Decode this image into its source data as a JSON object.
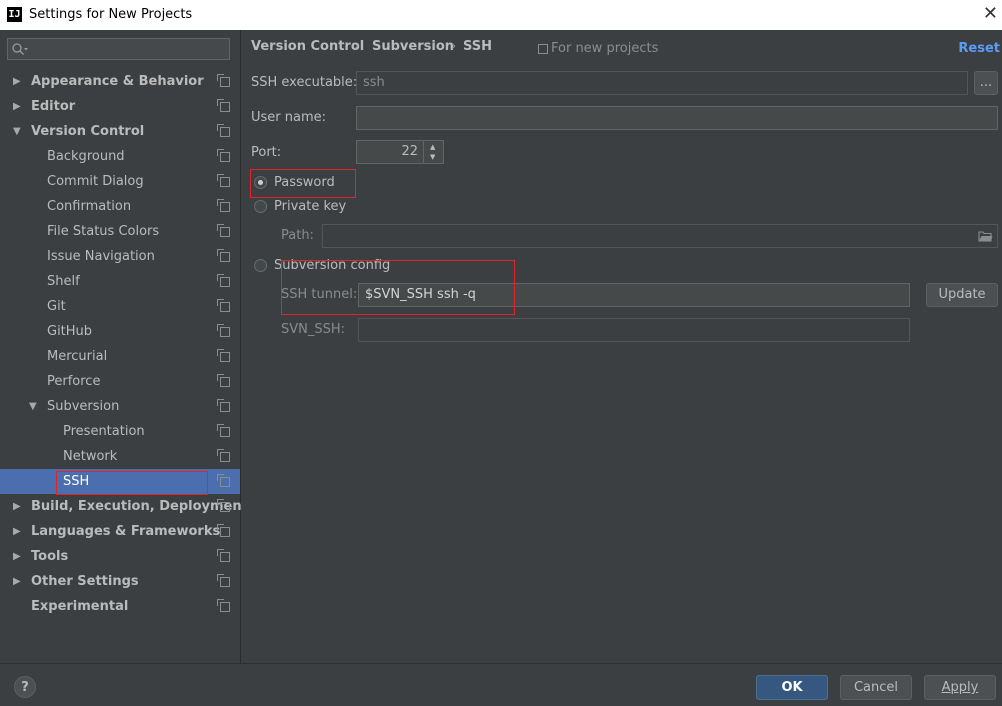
{
  "window": {
    "app_icon": "IJ",
    "title": "Settings for New Projects",
    "close": "✕"
  },
  "search": {
    "placeholder": "",
    "icon": "search-icon"
  },
  "tree": [
    {
      "label": "Appearance & Behavior",
      "bold": true,
      "arrow": "▶",
      "level": 0
    },
    {
      "label": "Editor",
      "bold": true,
      "arrow": "▶",
      "level": 0
    },
    {
      "label": "Version Control",
      "bold": true,
      "arrow": "▼",
      "level": 0
    },
    {
      "label": "Background",
      "bold": false,
      "arrow": "",
      "level": 1
    },
    {
      "label": "Commit Dialog",
      "bold": false,
      "arrow": "",
      "level": 1
    },
    {
      "label": "Confirmation",
      "bold": false,
      "arrow": "",
      "level": 1
    },
    {
      "label": "File Status Colors",
      "bold": false,
      "arrow": "",
      "level": 1
    },
    {
      "label": "Issue Navigation",
      "bold": false,
      "arrow": "",
      "level": 1
    },
    {
      "label": "Shelf",
      "bold": false,
      "arrow": "",
      "level": 1
    },
    {
      "label": "Git",
      "bold": false,
      "arrow": "",
      "level": 1
    },
    {
      "label": "GitHub",
      "bold": false,
      "arrow": "",
      "level": 1
    },
    {
      "label": "Mercurial",
      "bold": false,
      "arrow": "",
      "level": 1
    },
    {
      "label": "Perforce",
      "bold": false,
      "arrow": "",
      "level": 1
    },
    {
      "label": "Subversion",
      "bold": false,
      "arrow": "▼",
      "level": 1
    },
    {
      "label": "Presentation",
      "bold": false,
      "arrow": "",
      "level": 2
    },
    {
      "label": "Network",
      "bold": false,
      "arrow": "",
      "level": 2
    },
    {
      "label": "SSH",
      "bold": false,
      "arrow": "",
      "level": 2,
      "selected": true
    },
    {
      "label": "Build, Execution, Deployment",
      "bold": true,
      "arrow": "▶",
      "level": 0
    },
    {
      "label": "Languages & Frameworks",
      "bold": true,
      "arrow": "▶",
      "level": 0
    },
    {
      "label": "Tools",
      "bold": true,
      "arrow": "▶",
      "level": 0
    },
    {
      "label": "Other Settings",
      "bold": true,
      "arrow": "▶",
      "level": 0
    },
    {
      "label": "Experimental",
      "bold": true,
      "arrow": "",
      "level": 0
    }
  ],
  "breadcrumb": {
    "items": [
      "Version Control",
      "Subversion",
      "SSH"
    ],
    "separator": "›"
  },
  "for_new_projects": "For new projects",
  "reset_label": "Reset",
  "form": {
    "ssh_executable_label": "SSH executable:",
    "ssh_executable_value": "ssh",
    "browse_label": "...",
    "user_name_label": "User name:",
    "user_name_value": "",
    "port_label": "Port:",
    "port_value": "22",
    "password_label": "Password",
    "private_key_label": "Private key",
    "path_label": "Path:",
    "path_value": "",
    "subversion_config_label": "Subversion config",
    "ssh_tunnel_label": "SSH tunnel:",
    "ssh_tunnel_value": "$SVN_SSH ssh -q",
    "update_label": "Update",
    "svn_ssh_label": "SVN_SSH:",
    "svn_ssh_value": "",
    "selected_auth": "password"
  },
  "footer": {
    "help_label": "?",
    "ok_label": "OK",
    "cancel_label": "Cancel",
    "apply_label": "Apply"
  },
  "colors": {
    "background": "#3c3f41",
    "selection": "#4b6eaf",
    "link": "#589df6",
    "highlight_box": "#e0242a",
    "ok_button": "#365880"
  }
}
